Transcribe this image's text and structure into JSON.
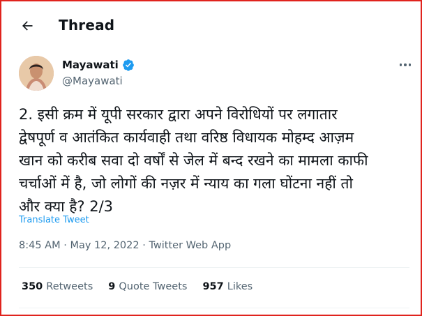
{
  "header": {
    "title": "Thread"
  },
  "author": {
    "name": "Mayawati",
    "handle": "@Mayawati"
  },
  "tweet": {
    "text": "2. इसी क्रम में यूपी सरकार द्वारा अपने विरोधियों पर लगातार\nद्वेषपूर्ण व आतंकित कार्यवाही तथा वरिष्ठ विधायक मोहम्द आज़म\nखान को करीब सवा दो वर्षों से जेल में बन्द रखने का मामला काफी\nचर्चाओं में है, जो लोगों की नज़र में न्याय का गला घोंटना नहीं तो\nऔर क्या है? 2/3",
    "translate_label": "Translate Tweet",
    "time": "8:45 AM",
    "date": "May 12, 2022",
    "source": "Twitter Web App",
    "separator": "·"
  },
  "stats": {
    "retweets_count": "350",
    "retweets_label": "Retweets",
    "quotes_count": "9",
    "quotes_label": "Quote Tweets",
    "likes_count": "957",
    "likes_label": "Likes"
  },
  "icons": {
    "back": "arrow-left-icon",
    "verified": "verified-badge-icon",
    "more": "more-dots-icon"
  },
  "colors": {
    "accent": "#1d9bf0",
    "frame": "#e0231d",
    "secondary_text": "#536471"
  }
}
